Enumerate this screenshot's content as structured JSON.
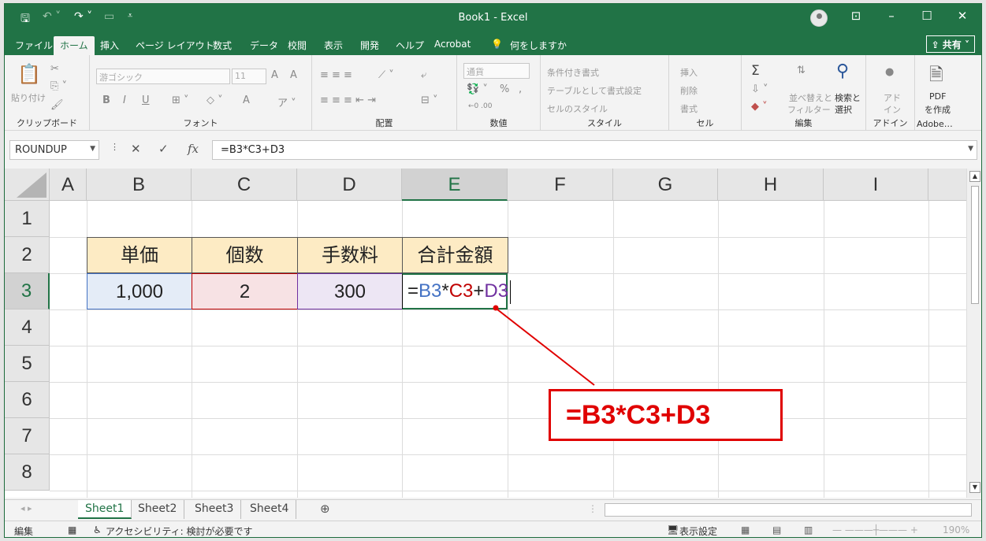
{
  "titlebar": {
    "title": "Book1  -  Excel",
    "save_icon": "save-icon",
    "controls": [
      "ribbon-display-icon",
      "minimize-icon",
      "restore-icon",
      "close-icon"
    ]
  },
  "menu": {
    "tabs": [
      "ファイル",
      "ホーム",
      "挿入",
      "ページ レイアウト",
      "数式",
      "データ",
      "校閲",
      "表示",
      "開発",
      "ヘルプ",
      "Acrobat"
    ],
    "active": "ホーム",
    "tell_me": "何をしますか",
    "share": "共有"
  },
  "ribbon": {
    "clipboard": {
      "paste": "貼り付け",
      "label": "クリップボード"
    },
    "font": {
      "name": "游ゴシック",
      "size": "11",
      "bold": "B",
      "italic": "I",
      "underline": "U",
      "grow": "A",
      "shrink": "A",
      "color": "A",
      "label": "フォント"
    },
    "alignment": {
      "label": "配置"
    },
    "number": {
      "format": "通貨",
      "percent": "%",
      "comma": ",",
      "label": "数値"
    },
    "styles": {
      "conditional": "条件付き書式",
      "table": "テーブルとして書式設定",
      "cell": "セルのスタイル",
      "label": "スタイル"
    },
    "cells": {
      "insert": "挿入",
      "delete": "削除",
      "format": "書式",
      "label": "セル"
    },
    "editing": {
      "sum": "Σ",
      "sort1": "並べ替えと",
      "sort2": "フィルター",
      "find1": "検索と",
      "find2": "選択",
      "label": "編集"
    },
    "addins": {
      "l1": "アド",
      "l2": "イン",
      "label": "アドイン"
    },
    "adobe": {
      "l1": "PDF",
      "l2": "を作成",
      "label": "Adobe…"
    }
  },
  "formula_bar": {
    "name_box": "ROUNDUP",
    "fx": "fx",
    "cancel": "✕",
    "enter": "✓",
    "formula": "=B3*C3+D3"
  },
  "grid": {
    "columns": [
      "A",
      "B",
      "C",
      "D",
      "E",
      "F",
      "G",
      "H",
      "I"
    ],
    "rows": [
      "1",
      "2",
      "3",
      "4",
      "5",
      "6",
      "7",
      "8"
    ],
    "selected_column": "E",
    "selected_row": "3",
    "headers": [
      "単価",
      "個数",
      "手数料",
      "合計金額"
    ],
    "values": [
      "1,000",
      "2",
      "300"
    ],
    "edit_formula": {
      "eq": "=",
      "ref1": "B3",
      "op1": "*",
      "ref2": "C3",
      "op2": "+",
      "ref3": "D3"
    },
    "ref_colors": {
      "b3": "#4472c4",
      "c3": "#c00000",
      "d3": "#7030a0"
    },
    "header_fill": "#fdebc4"
  },
  "callout": {
    "text": "=B3*C3+D3",
    "color": "#e00000"
  },
  "sheets": {
    "tabs": [
      "Sheet1",
      "Sheet2",
      "Sheet3",
      "Sheet4"
    ],
    "active": "Sheet1",
    "add": "+"
  },
  "status": {
    "mode": "編集",
    "accessibility": "アクセシビリティ: 検討が必要です",
    "display_settings": "表示設定",
    "zoom": "190%"
  }
}
